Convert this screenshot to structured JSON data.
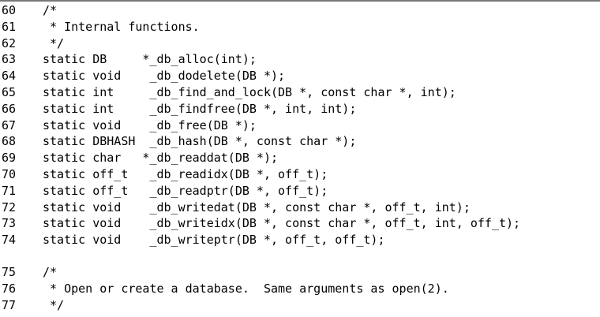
{
  "listing": {
    "block1": [
      {
        "num": "60",
        "text": "/*"
      },
      {
        "num": "61",
        "text": " * Internal functions."
      },
      {
        "num": "62",
        "text": " */"
      },
      {
        "num": "63",
        "text": "static DB     *_db_alloc(int);"
      },
      {
        "num": "64",
        "text": "static void    _db_dodelete(DB *);"
      },
      {
        "num": "65",
        "text": "static int     _db_find_and_lock(DB *, const char *, int);"
      },
      {
        "num": "66",
        "text": "static int     _db_findfree(DB *, int, int);"
      },
      {
        "num": "67",
        "text": "static void    _db_free(DB *);"
      },
      {
        "num": "68",
        "text": "static DBHASH  _db_hash(DB *, const char *);"
      },
      {
        "num": "69",
        "text": "static char   *_db_readdat(DB *);"
      },
      {
        "num": "70",
        "text": "static off_t   _db_readidx(DB *, off_t);"
      },
      {
        "num": "71",
        "text": "static off_t   _db_readptr(DB *, off_t);"
      },
      {
        "num": "72",
        "text": "static void    _db_writedat(DB *, const char *, off_t, int);"
      },
      {
        "num": "73",
        "text": "static void    _db_writeidx(DB *, const char *, off_t, int, off_t);"
      },
      {
        "num": "74",
        "text": "static void    _db_writeptr(DB *, off_t, off_t);"
      }
    ],
    "block2": [
      {
        "num": "75",
        "text": "/*"
      },
      {
        "num": "76",
        "text": " * Open or create a database.  Same arguments as open(2)."
      },
      {
        "num": "77",
        "text": " */"
      }
    ]
  }
}
